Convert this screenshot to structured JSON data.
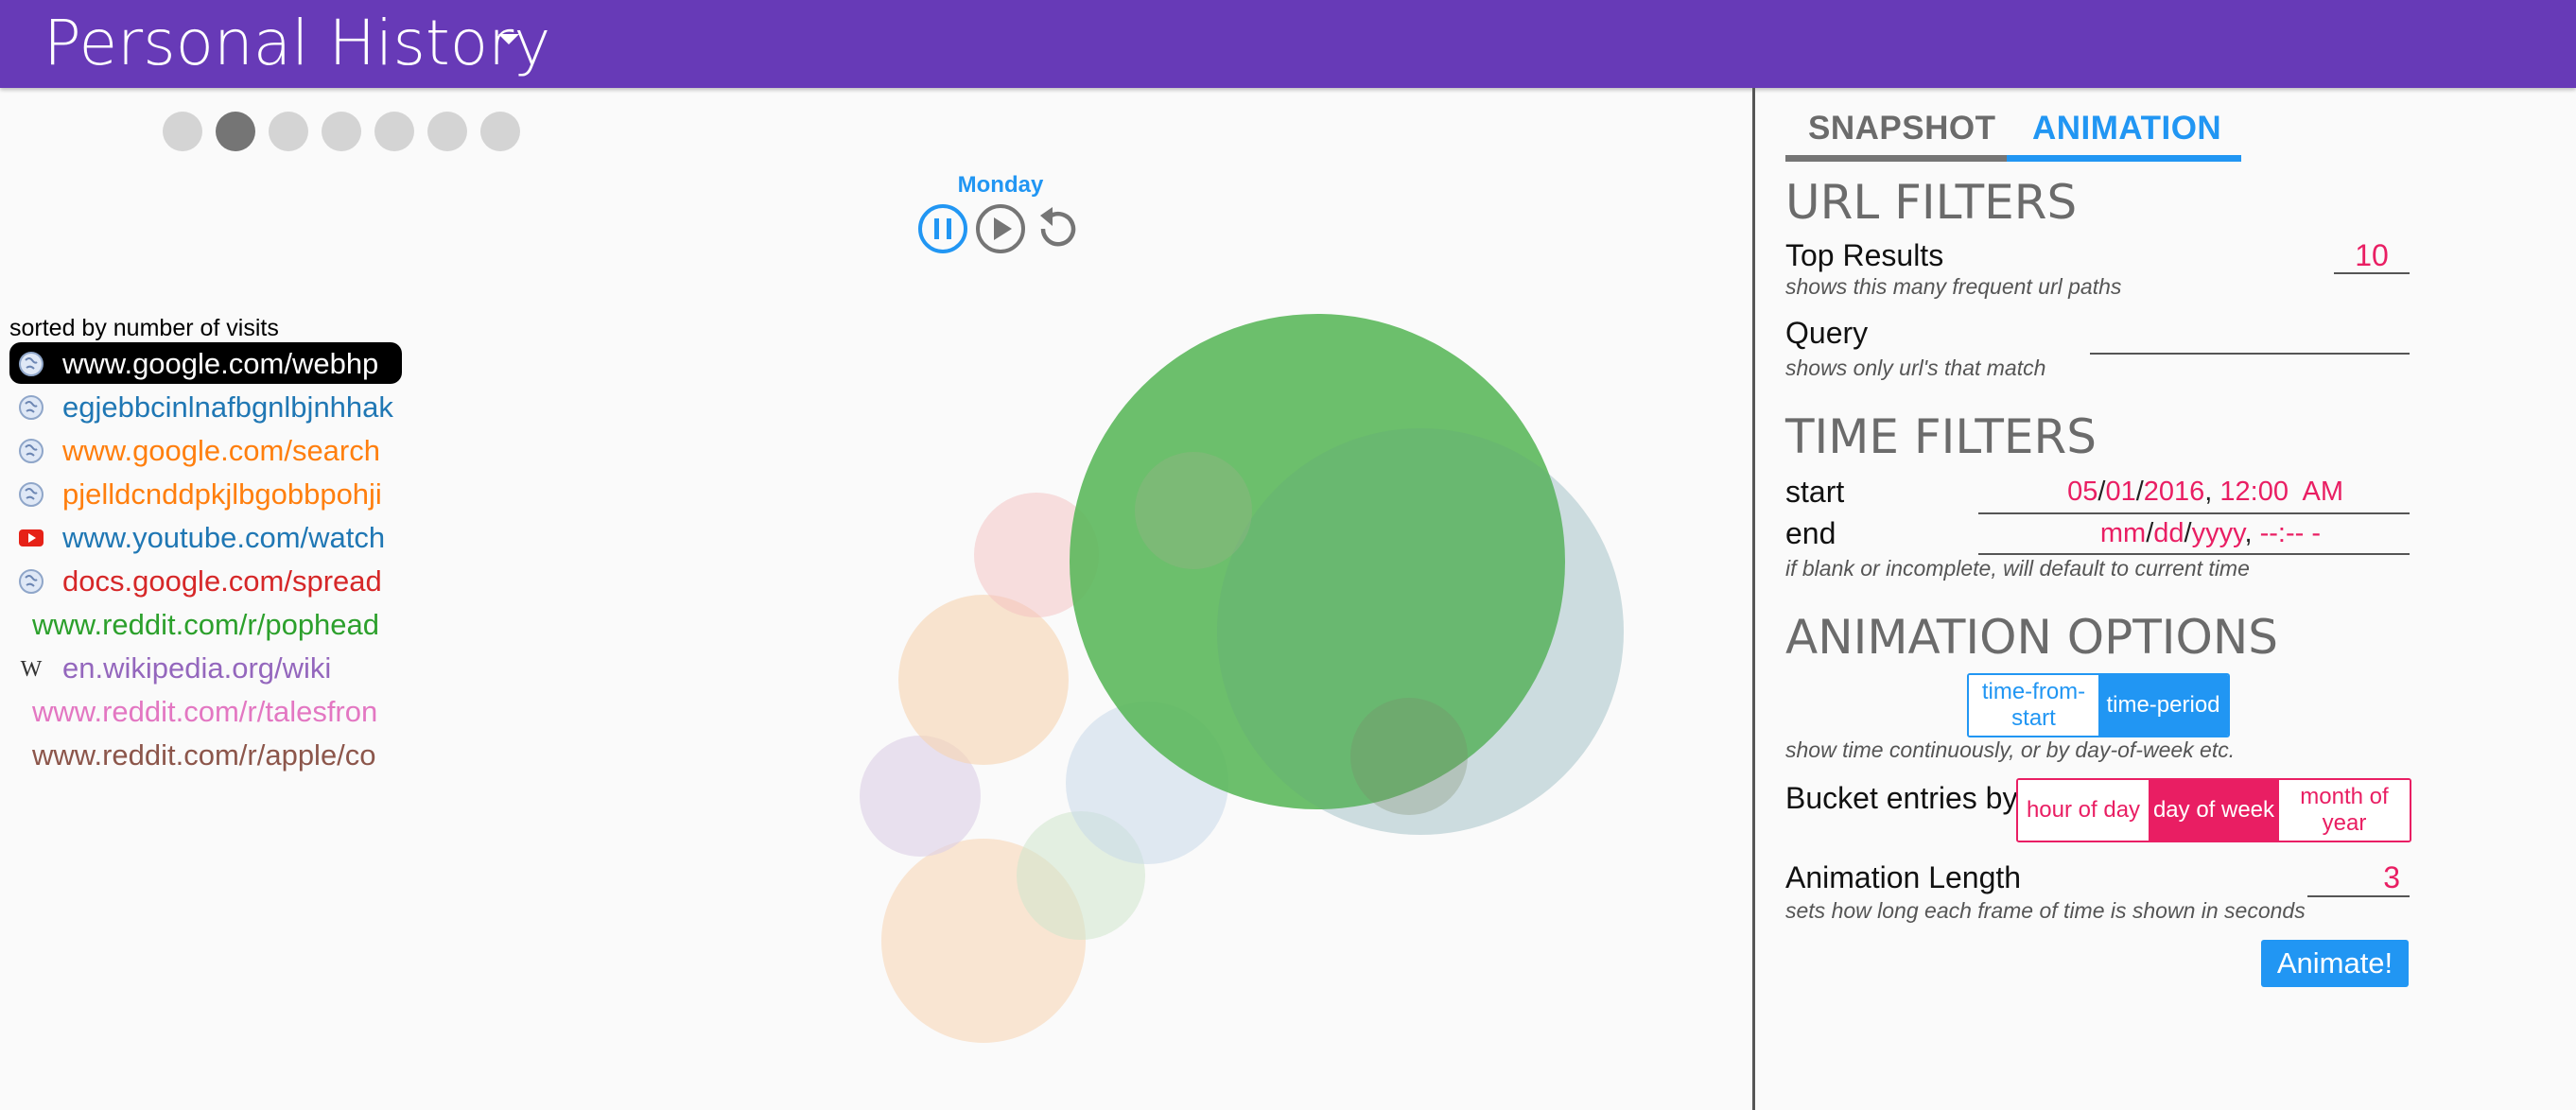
{
  "header": {
    "title": "Personal History"
  },
  "page_dots": {
    "count": 7,
    "active_index": 1
  },
  "playback": {
    "current_bucket": "Monday"
  },
  "url_list": {
    "caption": "sorted by number of visits",
    "items": [
      {
        "text": "www.google.com/webhp",
        "color": "#ffffff",
        "icon": "globe-icon"
      },
      {
        "text": "egjebbcinlnafbgnlbjnhhak",
        "color": "#1f77b4",
        "icon": "globe-icon"
      },
      {
        "text": "www.google.com/search",
        "color": "#ff7f0e",
        "icon": "globe-icon"
      },
      {
        "text": "pjelldcnddpkjlbgobbpohji",
        "color": "#ff7f0e",
        "icon": "globe-icon"
      },
      {
        "text": "www.youtube.com/watch",
        "color": "#1f77b4",
        "icon": "youtube-icon"
      },
      {
        "text": "docs.google.com/spread",
        "color": "#d62728",
        "icon": "globe-icon"
      },
      {
        "text": "www.reddit.com/r/pophead",
        "color": "#2ca02c",
        "icon": ""
      },
      {
        "text": "en.wikipedia.org/wiki",
        "color": "#9467bd",
        "icon": "wikipedia-icon"
      },
      {
        "text": "www.reddit.com/r/talesfron",
        "color": "#e377c2",
        "icon": ""
      },
      {
        "text": "www.reddit.com/r/apple/co",
        "color": "#8c564b",
        "icon": ""
      }
    ]
  },
  "bubbles": {
    "colors": {
      "green": "#5cb85c",
      "pale_blue": "#c9d9ea",
      "pale_orange": "#f7d3b0",
      "pale_pink": "#f4c0c0",
      "pale_purple": "#dccfe6",
      "pale_green": "#cfe5cc"
    }
  },
  "tabs": {
    "snapshot": "SNAPSHOT",
    "animation": "ANIMATION",
    "active": "animation"
  },
  "url_filters": {
    "heading": "URL FILTERS",
    "top_results_label": "Top Results",
    "top_results_value": "10",
    "top_results_hint": "shows this many frequent url paths",
    "query_label": "Query",
    "query_value": "",
    "query_hint": "shows only url's that match"
  },
  "time_filters": {
    "heading": "TIME FILTERS",
    "start_label": "start",
    "start": {
      "month": "05",
      "day": "01",
      "year": "2016",
      "time": "12:00",
      "ampm": "AM"
    },
    "end_label": "end",
    "end": {
      "month": "mm",
      "day": "dd",
      "year": "yyyy",
      "time": "--:-- -"
    },
    "hint": "if blank or incomplete, will default to current time"
  },
  "animation_options": {
    "heading": "ANIMATION OPTIONS",
    "time_mode": [
      "time-from-start",
      "time-period"
    ],
    "time_mode_selected": "time-period",
    "time_mode_hint": "show time continuously, or by day-of-week etc.",
    "bucket_label": "Bucket entries by",
    "bucket_options": [
      "hour of day",
      "day of week",
      "month of year"
    ],
    "bucket_selected": "day of week",
    "length_label": "Animation Length",
    "length_value": "3",
    "length_hint": "sets how long each frame of time is shown in seconds",
    "animate_button": "Animate!"
  },
  "colors": {
    "header_bg": "#673ab7",
    "accent_blue": "#2196f3",
    "accent_pink": "#e91e63"
  }
}
